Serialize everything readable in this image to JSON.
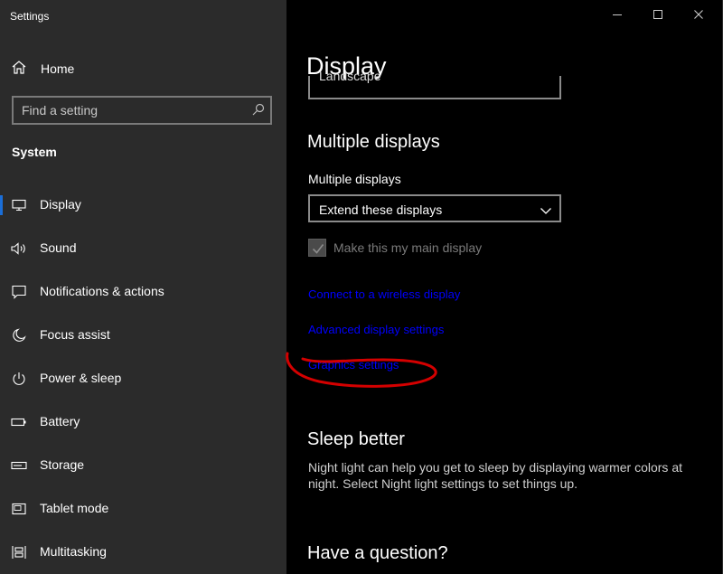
{
  "window": {
    "title": "Settings"
  },
  "sidebar": {
    "home_label": "Home",
    "search_placeholder": "Find a setting",
    "section": "System",
    "items": [
      {
        "label": "Display",
        "icon": "monitor-icon",
        "selected": true
      },
      {
        "label": "Sound",
        "icon": "speaker-icon"
      },
      {
        "label": "Notifications & actions",
        "icon": "notification-icon"
      },
      {
        "label": "Focus assist",
        "icon": "moon-icon"
      },
      {
        "label": "Power & sleep",
        "icon": "power-icon"
      },
      {
        "label": "Battery",
        "icon": "battery-icon"
      },
      {
        "label": "Storage",
        "icon": "storage-icon"
      },
      {
        "label": "Tablet mode",
        "icon": "tablet-icon"
      },
      {
        "label": "Multitasking",
        "icon": "multitasking-icon"
      }
    ]
  },
  "main": {
    "title": "Display",
    "partial_value": "Landscape",
    "multiple_displays": {
      "heading": "Multiple displays",
      "field_label": "Multiple displays",
      "dropdown_value": "Extend these displays",
      "checkbox_label": "Make this my main display",
      "checkbox_checked": true
    },
    "links": [
      "Connect to a wireless display",
      "Advanced display settings",
      "Graphics settings"
    ],
    "sleep": {
      "heading": "Sleep better",
      "text": "Night light can help you get to sleep by displaying warmer colors at night. Select Night light settings to set things up."
    },
    "question_heading": "Have a question?"
  },
  "colors": {
    "sidebar_bg": "#2b2b2b",
    "main_bg": "#000000",
    "link": "#0000ff",
    "accent": "#1a6ed8",
    "annotation": "#d40000"
  }
}
